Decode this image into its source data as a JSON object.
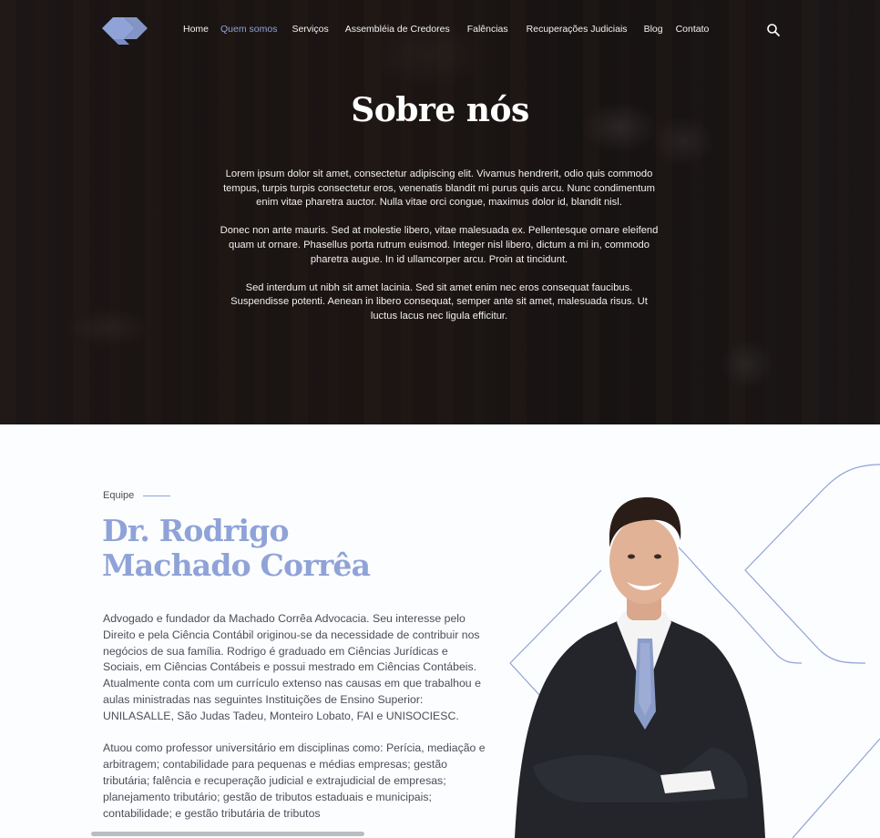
{
  "nav": {
    "items": [
      {
        "label": "Home",
        "active": false
      },
      {
        "label": "Quem somos",
        "active": true
      },
      {
        "label": "Serviços",
        "active": false
      },
      {
        "label": "Assembléia de Credores",
        "active": false
      },
      {
        "label": "Falências",
        "active": false
      },
      {
        "label": "Recuperações Judiciais",
        "active": false
      },
      {
        "label": "Blog",
        "active": false
      },
      {
        "label": "Contato",
        "active": false
      }
    ],
    "search_icon": "search-icon",
    "logo_icon": "diamond-logo"
  },
  "hero": {
    "title": "Sobre nós",
    "paragraphs": [
      "Lorem ipsum dolor sit amet, consectetur adipiscing elit. Vivamus hendrerit, odio quis commodo tempus, turpis turpis consectetur eros, venenatis blandit mi purus quis arcu. Nunc condimentum enim vitae pharetra auctor. Nulla vitae orci congue, maximus dolor id, blandit nisl.",
      "Donec non ante mauris. Sed at molestie libero, vitae malesuada ex. Pellentesque ornare eleifend quam ut ornare. Phasellus porta rutrum euismod. Integer nisl libero, dictum a mi in, commodo pharetra augue. In id ullamcorper arcu. Proin at tincidunt.",
      "Sed interdum ut nibh sit amet lacinia. Sed sit amet enim nec eros consequat faucibus. Suspendisse potenti. Aenean in libero consequat, semper ante sit amet, malesuada risus. Ut luctus lacus nec ligula efficitur."
    ]
  },
  "team": {
    "eyebrow": "Equipe",
    "name_line1": "Dr. Rodrigo",
    "name_line2": "Machado Corrêa",
    "bio": [
      "Advogado e fundador da Machado Corrêa Advocacia. Seu interesse pelo Direito e pela Ciência Contábil originou-se da necessidade de contribuir nos negócios de sua família. Rodrigo é graduado em Ciências Jurídicas e Sociais, em Ciências Contábeis e possui mestrado em Ciências Contábeis. Atualmente conta com um currículo extenso nas causas em que trabalhou e aulas ministradas nas seguintes Instituições de Ensino Superior: UNILASALLE, São Judas Tadeu, Monteiro Lobato, FAI e UNISOCIESC.",
      "Atuou como professor universitário em disciplinas como: Perícia, mediação e arbitragem; contabilidade para pequenas e médias empresas; gestão tributária; falência e recuperação judicial e extrajudicial de empresas; planejamento tributário; gestão de tributos estaduais e municipais; contabilidade; e gestão tributária de tributos"
    ]
  },
  "colors": {
    "accent": "#8fa3d8",
    "text": "#4a4e58",
    "hero_bg": "#231c1b",
    "page_bg": "#fcfdfe"
  }
}
